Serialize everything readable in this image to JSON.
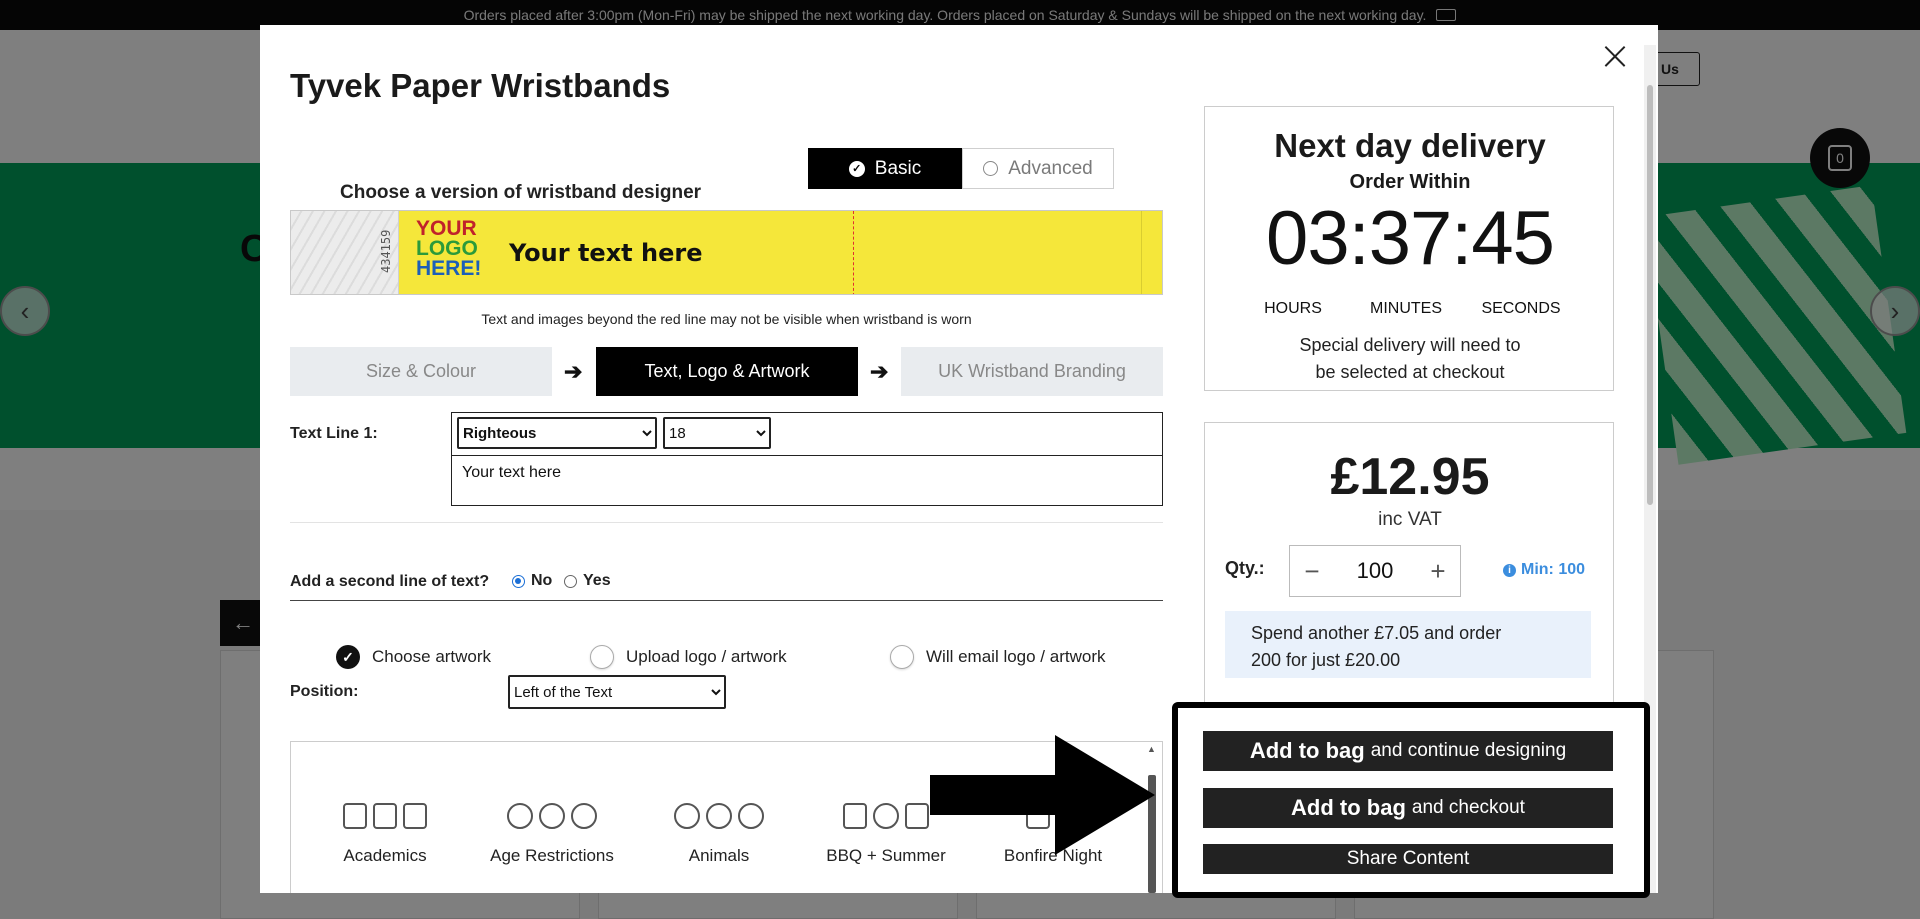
{
  "background": {
    "banner_text": "Orders placed after 3:00pm (Mon-Fri) may be shipped the next working day. Orders placed on Saturday & Sundays will be shipped on the next working day.",
    "contact_label": "Us",
    "bag_count": "0",
    "hero_heading": "C",
    "colors": {
      "hero": "#00a05a",
      "banner": "#0b0b0b"
    }
  },
  "modal": {
    "title": "Tyvek Paper Wristbands",
    "designer": {
      "label": "Choose a version of wristband designer",
      "basic_label": "Basic",
      "advanced_label": "Advanced"
    },
    "preview": {
      "serial": "434159",
      "logo_lines": [
        "YOUR",
        "LOGO",
        "HERE!"
      ],
      "text": "Your text here",
      "note": "Text and images beyond the red line may not be visible when wristband is worn"
    },
    "steps": [
      {
        "label": "Size & Colour",
        "active": false
      },
      {
        "label": "Text, Logo & Artwork",
        "active": true
      },
      {
        "label": "UK Wristband Branding",
        "active": false
      }
    ],
    "text_line_1": {
      "label": "Text Line 1:",
      "font": "Righteous",
      "size": "18",
      "value": "Your text here"
    },
    "second_line": {
      "label": "Add a second line of text?",
      "no_label": "No",
      "yes_label": "Yes",
      "selected": "No"
    },
    "artwork_options": [
      {
        "label": "Choose artwork",
        "selected": true
      },
      {
        "label": "Upload logo / artwork",
        "selected": false
      },
      {
        "label": "Will email logo / artwork",
        "selected": false
      }
    ],
    "position": {
      "label": "Position:",
      "value": "Left of the Text"
    },
    "categories": [
      "Academics",
      "Age Restrictions",
      "Animals",
      "BBQ + Summer",
      "Bonfire Night"
    ],
    "delivery": {
      "title": "Next day delivery",
      "subtitle": "Order Within",
      "hours": "03",
      "minutes": "37",
      "seconds": "45",
      "hours_label": "HOURS",
      "minutes_label": "MINUTES",
      "seconds_label": "SECONDS",
      "note_line1": "Special delivery will need to",
      "note_line2": "be selected at checkout"
    },
    "pricing": {
      "price": "£12.95",
      "vat": "inc VAT",
      "qty_label": "Qty.:",
      "qty_value": "100",
      "minus": "−",
      "plus": "+",
      "min_label": "Min: 100",
      "spend_line1": "Spend another £7.05 and order",
      "spend_line2": "200 for just £20.00"
    },
    "actions": {
      "add_continue_bold": "Add to bag",
      "add_continue_rest": "and continue designing",
      "add_checkout_bold": "Add to bag",
      "add_checkout_rest": "and checkout",
      "share": "Share Content"
    }
  }
}
